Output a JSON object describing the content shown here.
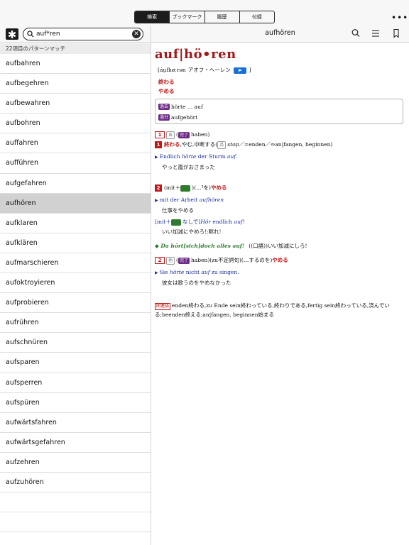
{
  "toolbar": {
    "tabs": [
      "検索",
      "ブックマーク",
      "履歴",
      "付録"
    ],
    "active_tab": 0,
    "more_label": "•••"
  },
  "search": {
    "asterisk_label": "✱",
    "query": "auf*ren",
    "match_count": "22項目のパターンマッチ"
  },
  "results": [
    "aufbahren",
    "aufbegehren",
    "aufbewahren",
    "aufbohren",
    "auffahren",
    "aufführen",
    "aufgefahren",
    "aufhören",
    "aufklaren",
    "aufklären",
    "aufmarschieren",
    "aufoktroyieren",
    "aufprobieren",
    "aufrühren",
    "aufschnüren",
    "aufsparen",
    "aufsperren",
    "aufspüren",
    "aufwärtsfahren",
    "aufwärtsgefahren",
    "aufzehren",
    "aufzuhören"
  ],
  "selected_index": 7,
  "entry": {
    "header_title": "aufhören",
    "headword": "auf|hö•ren",
    "pron_open": "[",
    "pronunciation": "áu̯fhøːrən",
    "katakana": "アオフ・ヘーレン",
    "pron_close": "]",
    "meanings": [
      "終わる",
      "やめる"
    ],
    "forms": [
      {
        "tag": "過去",
        "text": "hörte … auf"
      },
      {
        "tag": "過分",
        "text": "aufgehört"
      }
    ],
    "sense1_head": {
      "num": "1",
      "tag1": "自",
      "tag2": "完了",
      "text": "haben)"
    },
    "sense1_def": {
      "num": "1",
      "red": "終わる",
      "text": ",やむ,中断する(",
      "tag": "英",
      "en": "stop",
      "rest": "／=enden／⇔an|fangen, beginnen)"
    },
    "sense1_ex": {
      "de_pre": "Endlich ",
      "de_it1": "hörte",
      "de_mid": " der Sturm ",
      "de_it2": "auf",
      "de_post": ".",
      "jp": "やっと嵐がおさまった"
    },
    "sense2_head": {
      "num": "2",
      "pre": "(mit＋",
      "tag": "3格",
      "post": ")(…³を)",
      "red": "やめる"
    },
    "sense2_ex1": {
      "de_pre": "mit der Arbeit ",
      "de_it": "aufhören",
      "jp": "仕事をやめる"
    },
    "sense2_ex2": {
      "pre": "[mit＋",
      "tag": "3格",
      "mid": "なしで]",
      "de_it1": "Hör",
      "de_mid": " endlich ",
      "de_it2": "auf",
      "de_post": "!",
      "jp": "いい加減にやめろ!;黙れ!"
    },
    "idiom": {
      "text": "Da hört[sich]doch alles auf!",
      "gloss": "((口語))いい加減にしろ!"
    },
    "sense3_head": {
      "num": "2",
      "tag1": "他",
      "tag2": "完了",
      "text": "haben)(zu不定詞句)(…するのを)",
      "red": "やめる"
    },
    "sense3_ex": {
      "de_pre": "Sie ",
      "de_it1": "hörte",
      "de_mid": " nicht ",
      "de_it2": "auf",
      "de_post": " zu singen.",
      "jp": "彼女は歌うのをやめなかった"
    },
    "related": {
      "tag": "関連語",
      "text": "enden終わる,zu Ende sein終わっている,終わりである,fertig sein終わっている,済んでいる;beenden終える;an|fangen, beginnen始まる"
    }
  },
  "colors": {
    "headword": "#a01818",
    "accent_red": "#c01818",
    "example_blue": "#1a2f9a",
    "idiom_green": "#2f7a2f",
    "tag_purple": "#6b2a86"
  }
}
